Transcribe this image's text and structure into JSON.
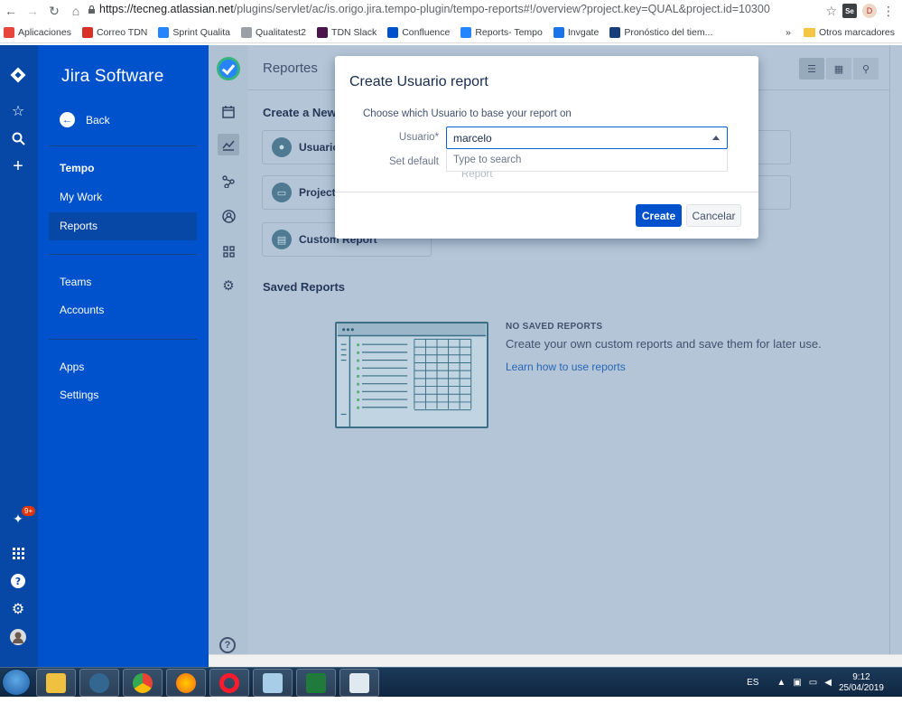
{
  "browser": {
    "url_host": "https://tecneg.atlassian.net",
    "url_rest": "/plugins/servlet/ac/is.origo.jira.tempo-plugin/tempo-reports#!/overview?project.key=QUAL&project.id=10300",
    "profile_initial": "D",
    "ext_label": "Se"
  },
  "bookmarks": {
    "items": [
      {
        "label": "Aplicaciones",
        "color": "#e8453c"
      },
      {
        "label": "Correo TDN",
        "color": "#d93025"
      },
      {
        "label": "Sprint Qualita",
        "color": "#2684ff"
      },
      {
        "label": "Qualitatest2",
        "color": "#9aa0a6"
      },
      {
        "label": "TDN Slack",
        "color": "#4a154b"
      },
      {
        "label": "Confluence",
        "color": "#0052cc"
      },
      {
        "label": "Reports- Tempo",
        "color": "#2684ff"
      },
      {
        "label": "Invgate",
        "color": "#1a73e8"
      },
      {
        "label": "Pronóstico del tiem...",
        "color": "#1a3e7a"
      }
    ],
    "more": "»",
    "other": "Otros marcadores"
  },
  "sidebar": {
    "brand": "Jira Software",
    "back": "Back",
    "section": "Tempo",
    "items": [
      "My Work",
      "Reports",
      "Teams",
      "Accounts",
      "Apps",
      "Settings"
    ],
    "badge": "9+"
  },
  "main": {
    "title": "Reportes",
    "create_heading": "Create a New",
    "cards": [
      "Usuario",
      "Project",
      "Custom Report"
    ],
    "saved_heading": "Saved Reports",
    "empty_title": "NO SAVED REPORTS",
    "empty_text": "Create your own custom reports and save them for later use.",
    "empty_link": "Learn how to use reports",
    "help": "?"
  },
  "modal": {
    "title": "Create Usuario report",
    "desc": "Choose which Usuario to base your report on",
    "user_label": "Usuario*",
    "user_value": "marcelo",
    "default_label": "Set default",
    "dropdown_hint": "Type to search",
    "behind_text": "Report",
    "create": "Create",
    "cancel": "Cancelar"
  },
  "taskbar": {
    "lang": "ES",
    "time": "9:12",
    "date": "25/04/2019"
  }
}
